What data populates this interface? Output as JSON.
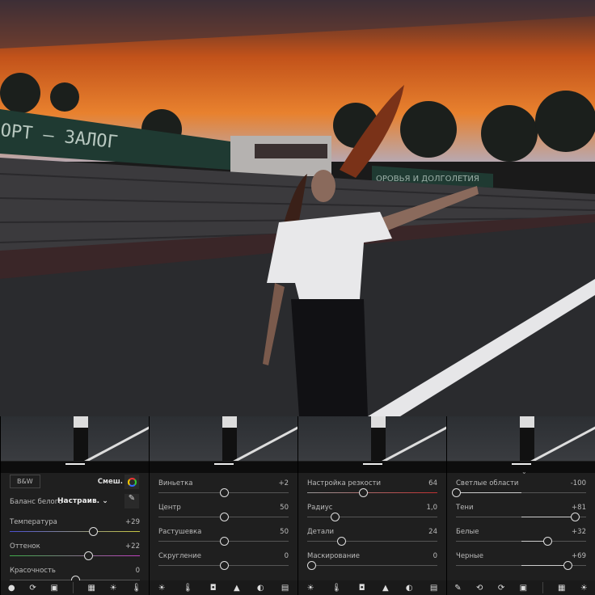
{
  "photo": {
    "signs": [
      "ОРТ – ЗАЛОГ",
      "ОРОВЬЯ И ДОЛГОЛЕТИЯ"
    ]
  },
  "panels": [
    {
      "name": "color",
      "bw_label": "B&W",
      "mix_label": "Смеш.",
      "wb_label": "Баланс белого",
      "wb_value": "Настраив.",
      "sliders": [
        {
          "label": "Температура",
          "value": "+29",
          "level": 0.64,
          "grad": "linear-gradient(90deg,#4a4fd0,#c8c840)"
        },
        {
          "label": "Оттенок",
          "value": "+22",
          "level": 0.6,
          "grad": "linear-gradient(90deg,#3fae4a,#c040c0)"
        },
        {
          "label": "Красочность",
          "value": "0",
          "level": 0.5
        }
      ],
      "tools": [
        "selection-icon",
        "crop-icon",
        "presets-icon",
        "|",
        "adjust-icon",
        "light-icon",
        "temperature-icon"
      ]
    },
    {
      "name": "effects",
      "sliders": [
        {
          "label": "Виньетка",
          "value": "+2",
          "level": 0.5
        },
        {
          "label": "Центр",
          "value": "50",
          "level": 0.5
        },
        {
          "label": "Растушевка",
          "value": "50",
          "level": 0.5
        },
        {
          "label": "Скругление",
          "value": "0",
          "level": 0.5
        }
      ],
      "tools": [
        "light-icon",
        "temperature-icon",
        "vignette-icon",
        "detail-icon",
        "optics-icon",
        "geometry-icon"
      ]
    },
    {
      "name": "detail",
      "sliders": [
        {
          "label": "Настройка резкости",
          "value": "64",
          "level": 0.43,
          "grad": "linear-gradient(90deg,#999,#c03030)"
        },
        {
          "label": "Радиус",
          "value": "1,0",
          "level": 0.21
        },
        {
          "label": "Детали",
          "value": "24",
          "level": 0.26
        },
        {
          "label": "Маскирование",
          "value": "0",
          "level": 0.03
        }
      ],
      "tools": [
        "light-icon",
        "temperature-icon",
        "vignette-icon",
        "detail-icon",
        "optics-icon",
        "geometry-icon"
      ]
    },
    {
      "name": "light",
      "sliders": [
        {
          "label": "Светлые области",
          "value": "-100",
          "level": 0.0,
          "center": true
        },
        {
          "label": "Тени",
          "value": "+81",
          "level": 0.91,
          "center": true
        },
        {
          "label": "Белые",
          "value": "+32",
          "level": 0.7,
          "center": true
        },
        {
          "label": "Черные",
          "value": "+69",
          "level": 0.86,
          "center": true
        }
      ],
      "tools": [
        "brush-icon",
        "heal-icon",
        "crop-icon",
        "presets-icon",
        "|",
        "adjust-icon",
        "light-icon"
      ]
    }
  ]
}
